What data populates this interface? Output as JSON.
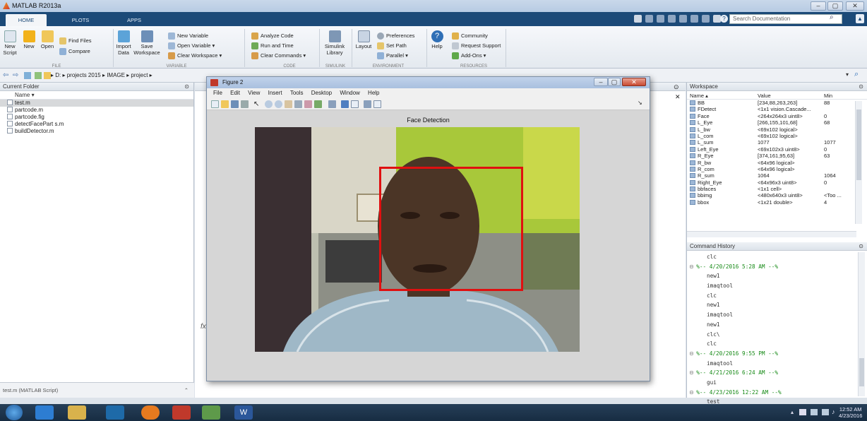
{
  "window": {
    "title": "MATLAB R2013a",
    "min": "–",
    "max": "▢",
    "close": "✕"
  },
  "tabs": [
    "HOME",
    "PLOTS",
    "APPS"
  ],
  "search": {
    "placeholder": "Search Documentation"
  },
  "ribbon": {
    "file": {
      "group": "FILE",
      "new_script": "New\nScript",
      "new": "New",
      "open": "Open",
      "find_files": "Find Files",
      "compare": "Compare"
    },
    "variable": {
      "group": "VARIABLE",
      "import": "Import\nData",
      "save": "Save\nWorkspace",
      "new_variable": "New Variable",
      "open_variable": "Open Variable ▾",
      "clear_workspace": "Clear Workspace ▾"
    },
    "code": {
      "group": "CODE",
      "analyze": "Analyze Code",
      "run_time": "Run and Time",
      "clear_commands": "Clear Commands ▾"
    },
    "simulink": {
      "group": "SIMULINK",
      "library": "Simulink\nLibrary"
    },
    "environment": {
      "group": "ENVIRONMENT",
      "layout": "Layout",
      "preferences": "Preferences",
      "set_path": "Set Path",
      "parallel": "Parallel ▾"
    },
    "resources": {
      "group": "RESOURCES",
      "help": "Help",
      "community": "Community",
      "request_support": "Request Support",
      "addons": "Add-Ons ▾"
    }
  },
  "address": "▸ D: ▸ projects 2015 ▸ IMAGE ▸ project ▸",
  "current_folder": {
    "title": "Current Folder",
    "col": "Name ▾",
    "files": [
      "test.m",
      "partcode.m",
      "partcode.fig",
      "detectFacePart s.m",
      "buildDetector.m"
    ],
    "status": "test.m (MATLAB Script)"
  },
  "figure": {
    "title": "Figure 2",
    "menu": [
      "File",
      "Edit",
      "View",
      "Insert",
      "Tools",
      "Desktop",
      "Window",
      "Help"
    ],
    "axes_title": "Face Detection",
    "fx": "fx"
  },
  "workspace": {
    "title": "Workspace",
    "cols": [
      "Name ▴",
      "Value",
      "Min"
    ],
    "rows": [
      [
        "BB",
        "[234,88,263,263]",
        "88"
      ],
      [
        "FDetect",
        "<1x1 vision.Cascade...",
        ""
      ],
      [
        "Face",
        "<264x264x3 uint8>",
        "0"
      ],
      [
        "L_Eye",
        "[266,155,101,68]",
        "68"
      ],
      [
        "L_bw",
        "<69x102 logical>",
        ""
      ],
      [
        "L_com",
        "<69x102 logical>",
        ""
      ],
      [
        "L_sum",
        "1077",
        "1077"
      ],
      [
        "Left_Eye",
        "<69x102x3 uint8>",
        "0"
      ],
      [
        "R_Eye",
        "[374,161,95,63]",
        "63"
      ],
      [
        "R_bw",
        "<64x96 logical>",
        ""
      ],
      [
        "R_com",
        "<64x96 logical>",
        ""
      ],
      [
        "R_sum",
        "1064",
        "1064"
      ],
      [
        "Right_Eye",
        "<64x96x3 uint8>",
        "0"
      ],
      [
        "bbfaces",
        "<1x1 cell>",
        ""
      ],
      [
        "bbimg",
        "<480x640x3 uint8>",
        "<Too ..."
      ],
      [
        "bbox",
        "<1x21 double>",
        "4"
      ]
    ]
  },
  "command_history": {
    "title": "Command History",
    "entries": [
      "clc",
      "%-- 4/20/2016 5:28 AM --%",
      "new1",
      "imaqtool",
      "clc",
      "new1",
      "imaqtool",
      "new1",
      "clc\\",
      "clc",
      "%-- 4/20/2016 9:55 PM --%",
      "imaqtool",
      "%-- 4/21/2016 6:24 AM --%",
      "gui",
      "%-- 4/23/2016 12:22 AM --%",
      "test"
    ]
  },
  "clock": {
    "time": "12:52 AM",
    "date": "4/23/2016"
  },
  "colors": {
    "ribbon_tab": "#1c4a78",
    "face_box": "#e01010",
    "history_session": "#168a16"
  }
}
